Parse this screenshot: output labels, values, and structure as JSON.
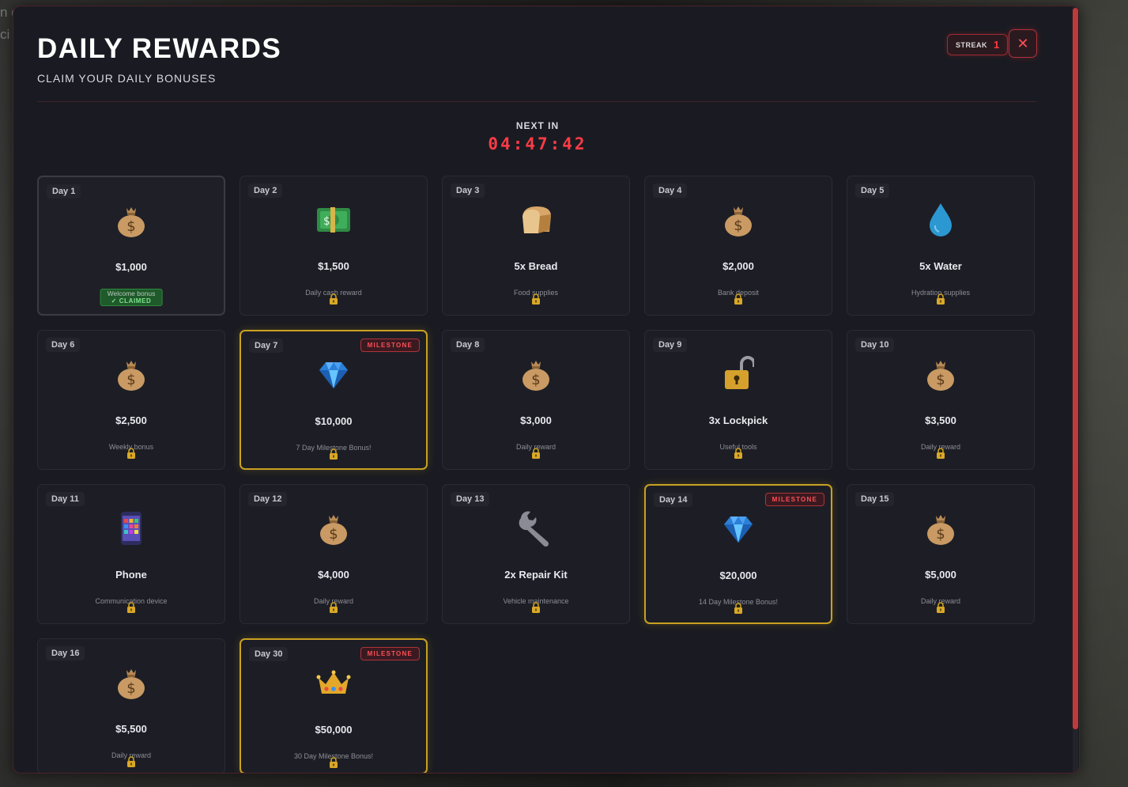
{
  "background_text": [
    "n o",
    "ci"
  ],
  "header": {
    "title": "DAILY REWARDS",
    "subtitle": "CLAIM YOUR DAILY BONUSES",
    "streak_label": "STREAK",
    "streak_value": "1",
    "close_glyph": "✕"
  },
  "countdown": {
    "label": "NEXT IN",
    "time": "04:47:42"
  },
  "colors": {
    "accent": "#ff3b45",
    "milestone_border": "#c9a020",
    "claimed_green": "#2f8a3d"
  },
  "rewards": [
    {
      "day": "Day 1",
      "amount": "$1,000",
      "desc": "Welcome bonus",
      "icon": "money-bag-icon",
      "status": "claimed",
      "claimed_label": "✓ CLAIMED"
    },
    {
      "day": "Day 2",
      "amount": "$1,500",
      "desc": "Daily cash reward",
      "icon": "cash-stack-icon",
      "status": "locked"
    },
    {
      "day": "Day 3",
      "amount": "5x Bread",
      "desc": "Food supplies",
      "icon": "bread-icon",
      "status": "locked"
    },
    {
      "day": "Day 4",
      "amount": "$2,000",
      "desc": "Bank deposit",
      "icon": "money-bag-icon",
      "status": "locked"
    },
    {
      "day": "Day 5",
      "amount": "5x Water",
      "desc": "Hydration supplies",
      "icon": "water-drop-icon",
      "status": "locked"
    },
    {
      "day": "Day 6",
      "amount": "$2,500",
      "desc": "Weekly bonus",
      "icon": "money-bag-icon",
      "status": "locked"
    },
    {
      "day": "Day 7",
      "amount": "$10,000",
      "desc": "7 Day Milestone Bonus!",
      "icon": "diamond-icon",
      "status": "locked",
      "milestone": "MILESTONE"
    },
    {
      "day": "Day 8",
      "amount": "$3,000",
      "desc": "Daily reward",
      "icon": "money-bag-icon",
      "status": "locked"
    },
    {
      "day": "Day 9",
      "amount": "3x Lockpick",
      "desc": "Useful tools",
      "icon": "open-padlock-icon",
      "status": "locked"
    },
    {
      "day": "Day 10",
      "amount": "$3,500",
      "desc": "Daily reward",
      "icon": "money-bag-icon",
      "status": "locked"
    },
    {
      "day": "Day 11",
      "amount": "Phone",
      "desc": "Communication device",
      "icon": "phone-icon",
      "status": "locked"
    },
    {
      "day": "Day 12",
      "amount": "$4,000",
      "desc": "Daily reward",
      "icon": "money-bag-icon",
      "status": "locked"
    },
    {
      "day": "Day 13",
      "amount": "2x Repair Kit",
      "desc": "Vehicle maintenance",
      "icon": "wrench-icon",
      "status": "locked"
    },
    {
      "day": "Day 14",
      "amount": "$20,000",
      "desc": "14 Day Milestone Bonus!",
      "icon": "diamond-icon",
      "status": "locked",
      "milestone": "MILESTONE"
    },
    {
      "day": "Day 15",
      "amount": "$5,000",
      "desc": "Daily reward",
      "icon": "money-bag-icon",
      "status": "locked"
    },
    {
      "day": "Day 16",
      "amount": "$5,500",
      "desc": "Daily reward",
      "icon": "money-bag-icon",
      "status": "locked"
    },
    {
      "day": "Day 30",
      "amount": "$50,000",
      "desc": "30 Day Milestone Bonus!",
      "icon": "crown-icon",
      "status": "locked",
      "milestone": "MILESTONE"
    }
  ]
}
